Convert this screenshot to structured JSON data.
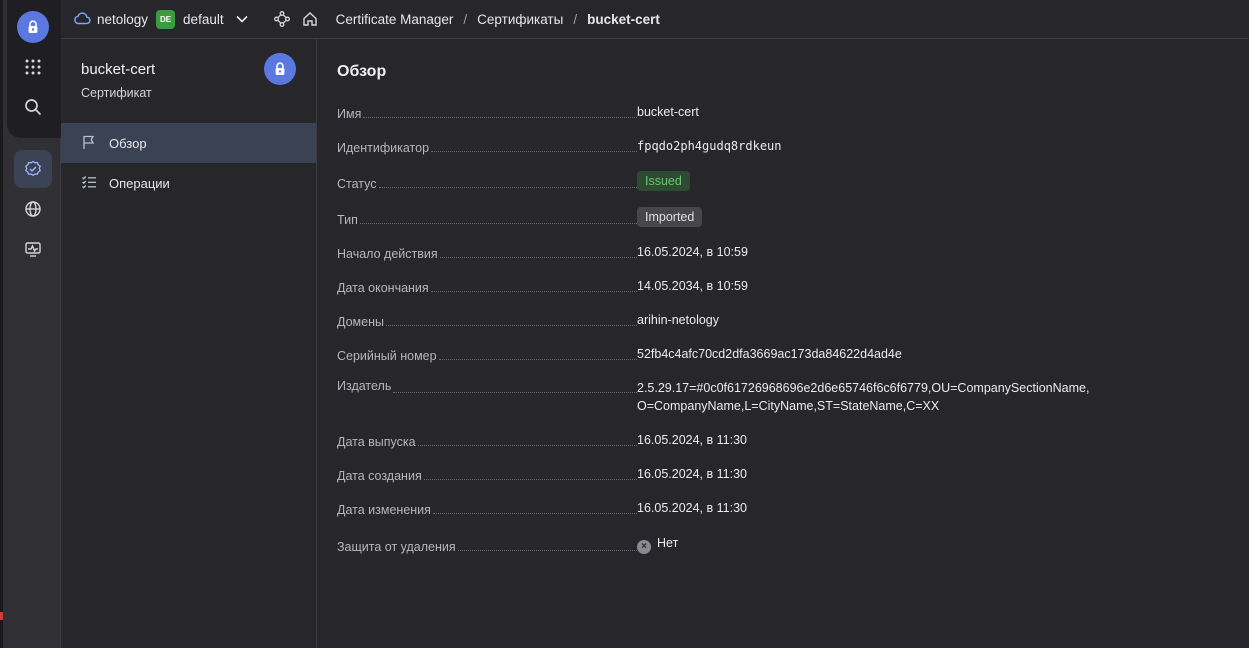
{
  "header": {
    "cloud_name": "netology",
    "folder_badge": "DE",
    "folder_name": "default",
    "breadcrumbs": [
      "Certificate Manager",
      "Сертификаты",
      "bucket-cert"
    ]
  },
  "sidebar": {
    "title": "bucket-cert",
    "subtitle": "Сертификат",
    "items": [
      {
        "label": "Обзор",
        "icon": "flag-icon",
        "active": true
      },
      {
        "label": "Операции",
        "icon": "checklist-icon",
        "active": false
      }
    ]
  },
  "main": {
    "title": "Обзор",
    "fields": {
      "name": {
        "key": "Имя",
        "value": "bucket-cert"
      },
      "id": {
        "key": "Идентификатор",
        "value": "fpqdo2ph4gudq8rdkeun"
      },
      "status": {
        "key": "Статус",
        "value": "Issued"
      },
      "type": {
        "key": "Тип",
        "value": "Imported"
      },
      "start": {
        "key": "Начало действия",
        "value": "16.05.2024, в 10:59"
      },
      "end": {
        "key": "Дата окончания",
        "value": "14.05.2034, в 10:59"
      },
      "domains": {
        "key": "Домены",
        "value": "arihin-netology"
      },
      "serial": {
        "key": "Серийный номер",
        "value": "52fb4c4afc70cd2dfa3669ac173da84622d4ad4e"
      },
      "issuer": {
        "key": "Издатель",
        "value_line1": "2.5.29.17=#0c0f61726968696e2d6e65746f6c6f6779,OU=CompanySectionName,",
        "value_line2": "O=CompanyName,L=CityName,ST=StateName,C=XX"
      },
      "issued": {
        "key": "Дата выпуска",
        "value": "16.05.2024, в 11:30"
      },
      "created": {
        "key": "Дата создания",
        "value": "16.05.2024, в 11:30"
      },
      "modified": {
        "key": "Дата изменения",
        "value": "16.05.2024, в 11:30"
      },
      "deletion_protection": {
        "key": "Защита от удаления",
        "value": "Нет"
      }
    }
  },
  "colors": {
    "accent": "#5b78e0",
    "status_issued": "#6cc46f",
    "folder_badge": "#3a9c3e"
  }
}
